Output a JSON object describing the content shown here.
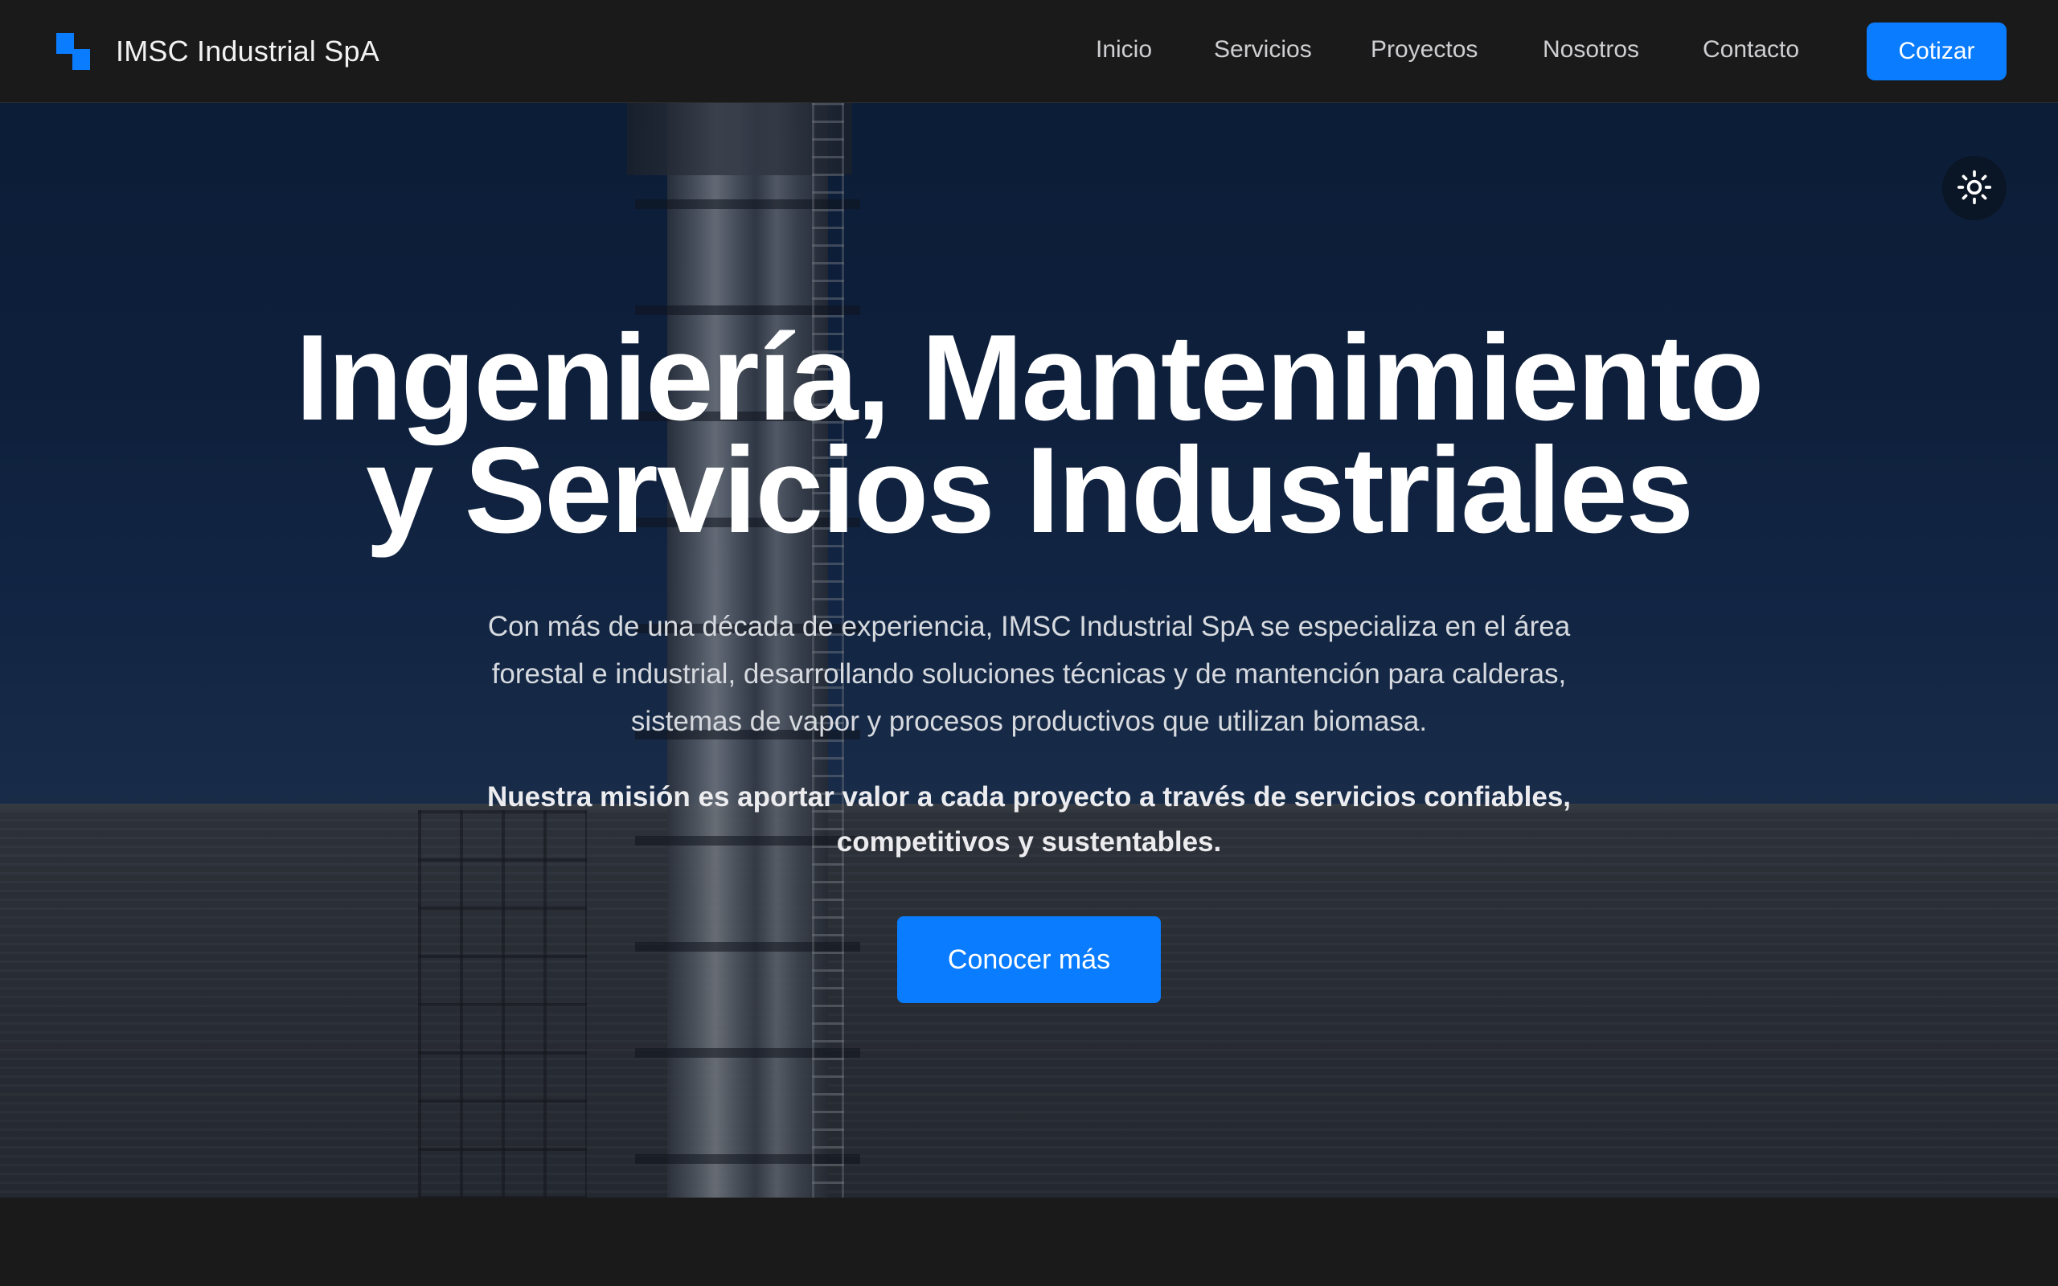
{
  "navbar": {
    "brand_name": "IMSC Industrial SpA",
    "logo_icon": "imsc-logo-icon",
    "links": [
      {
        "label": "Inicio"
      },
      {
        "label": "Servicios"
      },
      {
        "label": "Proyectos"
      },
      {
        "label": "Nosotros"
      },
      {
        "label": "Contacto"
      }
    ],
    "cta_label": "Cotizar"
  },
  "hero": {
    "theme_toggle_icon": "sun-icon",
    "title_line1": "Ingeniería, Mantenimiento",
    "title_line2": "y Servicios Industriales",
    "description": "Con más de una década de experiencia, IMSC Industrial SpA se especializa en el área forestal e industrial, desarrollando soluciones técnicas y de mantención para calderas, sistemas de vapor y procesos productivos que utilizan biomasa.",
    "mission": "Nuestra misión es aportar valor a cada proyecto a través de servicios confiables, competitivos y sustentables.",
    "button_label": "Conocer más",
    "background_image": "industrial-chimney-photo"
  },
  "colors": {
    "accent": "#0a7cff",
    "navbar_bg": "#1a1a1b",
    "text_primary": "#ffffff"
  }
}
